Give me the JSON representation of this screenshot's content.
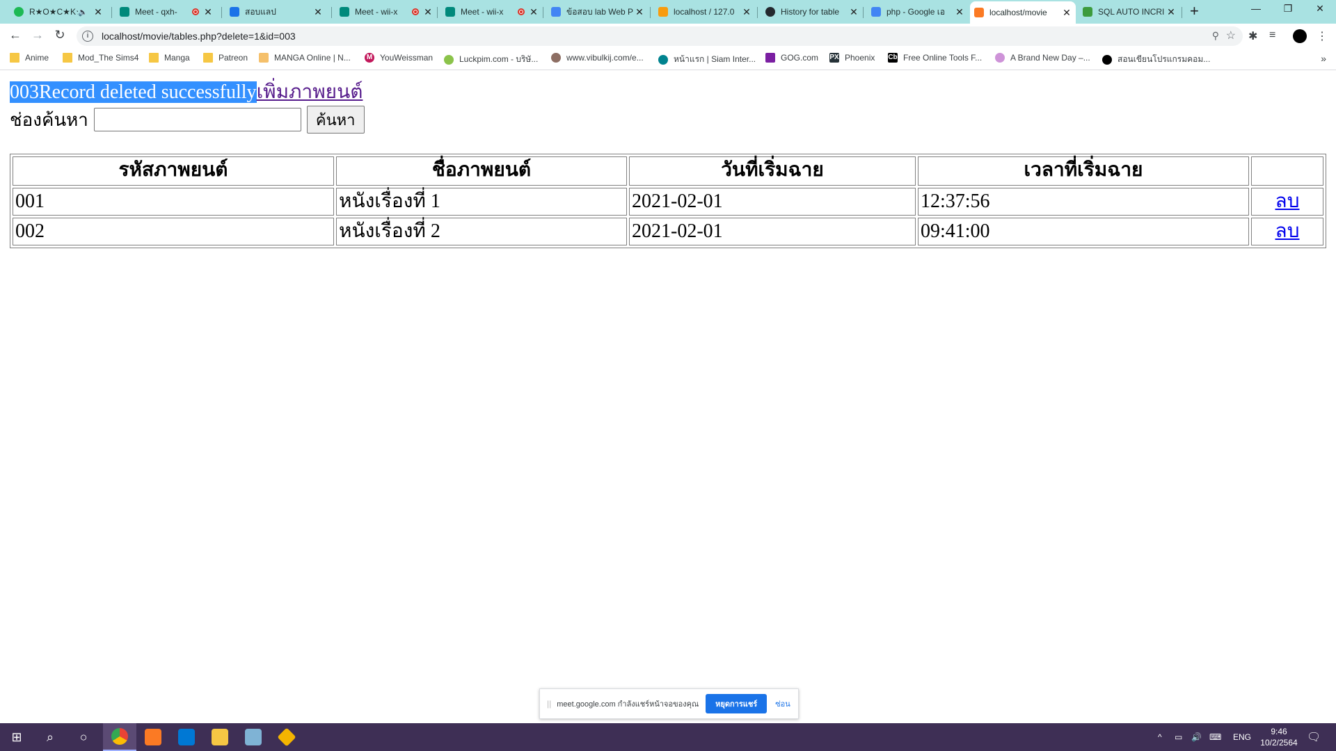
{
  "browser": {
    "tabs": [
      {
        "label": "R★O★C★K★",
        "icon_color": "#1db954",
        "icon": "spotify-icon",
        "extra": "mute"
      },
      {
        "label": "Meet - qxh-",
        "icon_color": "#00897b",
        "icon": "meet-icon",
        "extra": "record"
      },
      {
        "label": "สอบแลป",
        "icon_color": "#1a73e8",
        "icon": "classroom-icon",
        "extra": ""
      },
      {
        "label": "Meet - wii-x",
        "icon_color": "#00897b",
        "icon": "meet-icon",
        "extra": "record"
      },
      {
        "label": "Meet - wii-x",
        "icon_color": "#00897b",
        "icon": "meet-icon",
        "extra": "record"
      },
      {
        "label": "ข้อสอบ lab Web P",
        "icon_color": "#4285f4",
        "icon": "docs-icon",
        "extra": ""
      },
      {
        "label": "localhost / 127.0",
        "icon_color": "#f89c0e",
        "icon": "phpmyadmin-icon",
        "extra": ""
      },
      {
        "label": "History for table",
        "icon_color": "#24292e",
        "icon": "github-icon",
        "extra": ""
      },
      {
        "label": "php - Google เอ",
        "icon_color": "#4285f4",
        "icon": "docs-icon",
        "extra": ""
      },
      {
        "label": "localhost/movie",
        "icon_color": "#fb7a24",
        "icon": "xampp-icon",
        "extra": "",
        "active": true
      },
      {
        "label": "SQL AUTO INCRI",
        "icon_color": "#3d9b3d",
        "icon": "w3schools-icon",
        "extra": ""
      }
    ],
    "new_tab": "+",
    "window_controls": {
      "minimize": "—",
      "maximize": "❐",
      "close": "✕"
    },
    "url": "localhost/movie/tables.php?delete=1&id=003",
    "bookmarks": [
      {
        "label": "Anime",
        "type": "folder"
      },
      {
        "label": "Mod_The Sims4",
        "type": "folder"
      },
      {
        "label": "Manga",
        "type": "folder"
      },
      {
        "label": "Patreon",
        "type": "folder"
      },
      {
        "label": "MANGA Online | N...",
        "type": "site",
        "color": "#f5c06b"
      },
      {
        "label": "YouWeissman",
        "type": "site",
        "color": "#c2185b",
        "glyph": "M"
      },
      {
        "label": "Luckpim.com - บริษั...",
        "type": "site",
        "color": "#8bc34a"
      },
      {
        "label": "www.vibulkij.com/e...",
        "type": "site",
        "color": "#8d6e63"
      },
      {
        "label": "หน้าแรก | Siam Inter...",
        "type": "site",
        "color": "#00838f"
      },
      {
        "label": "GOG.com",
        "type": "site",
        "color": "#7b1fa2"
      },
      {
        "label": "Phoenix",
        "type": "site",
        "color": "#263238",
        "glyph": "PX"
      },
      {
        "label": "Free Online Tools F...",
        "type": "site",
        "color": "#000000",
        "glyph": "Cb"
      },
      {
        "label": "A Brand New Day –...",
        "type": "site",
        "color": "#ce93d8"
      },
      {
        "label": "สอนเขียนโปรแกรมคอม...",
        "type": "site",
        "color": "#000000"
      }
    ],
    "bookmarks_more": "»"
  },
  "page": {
    "status_message": "003Record deleted successfully",
    "add_movie_link": "เพิ่มภาพยนต์",
    "search_label": "ช่องค้นหา",
    "search_value": "",
    "search_button": "ค้นหา",
    "table": {
      "headers": [
        "รหัสภาพยนต์",
        "ชื่อภาพยนต์",
        "วันที่เริ่มฉาย",
        "เวลาที่เริ่มฉาย",
        ""
      ],
      "rows": [
        {
          "id": "001",
          "name": "หนังเรื่องที่ 1",
          "date": "2021-02-01",
          "time": "12:37:56",
          "action": "ลบ"
        },
        {
          "id": "002",
          "name": "หนังเรื่องที่ 2",
          "date": "2021-02-01",
          "time": "09:41:00",
          "action": "ลบ"
        }
      ]
    }
  },
  "share_bar": {
    "message": "meet.google.com กำลังแชร์หน้าจอของคุณ",
    "stop_button": "หยุดการแชร์",
    "hide_link": "ซ่อน"
  },
  "taskbar": {
    "language": "ENG",
    "time": "9:46",
    "date": "10/2/2564"
  }
}
